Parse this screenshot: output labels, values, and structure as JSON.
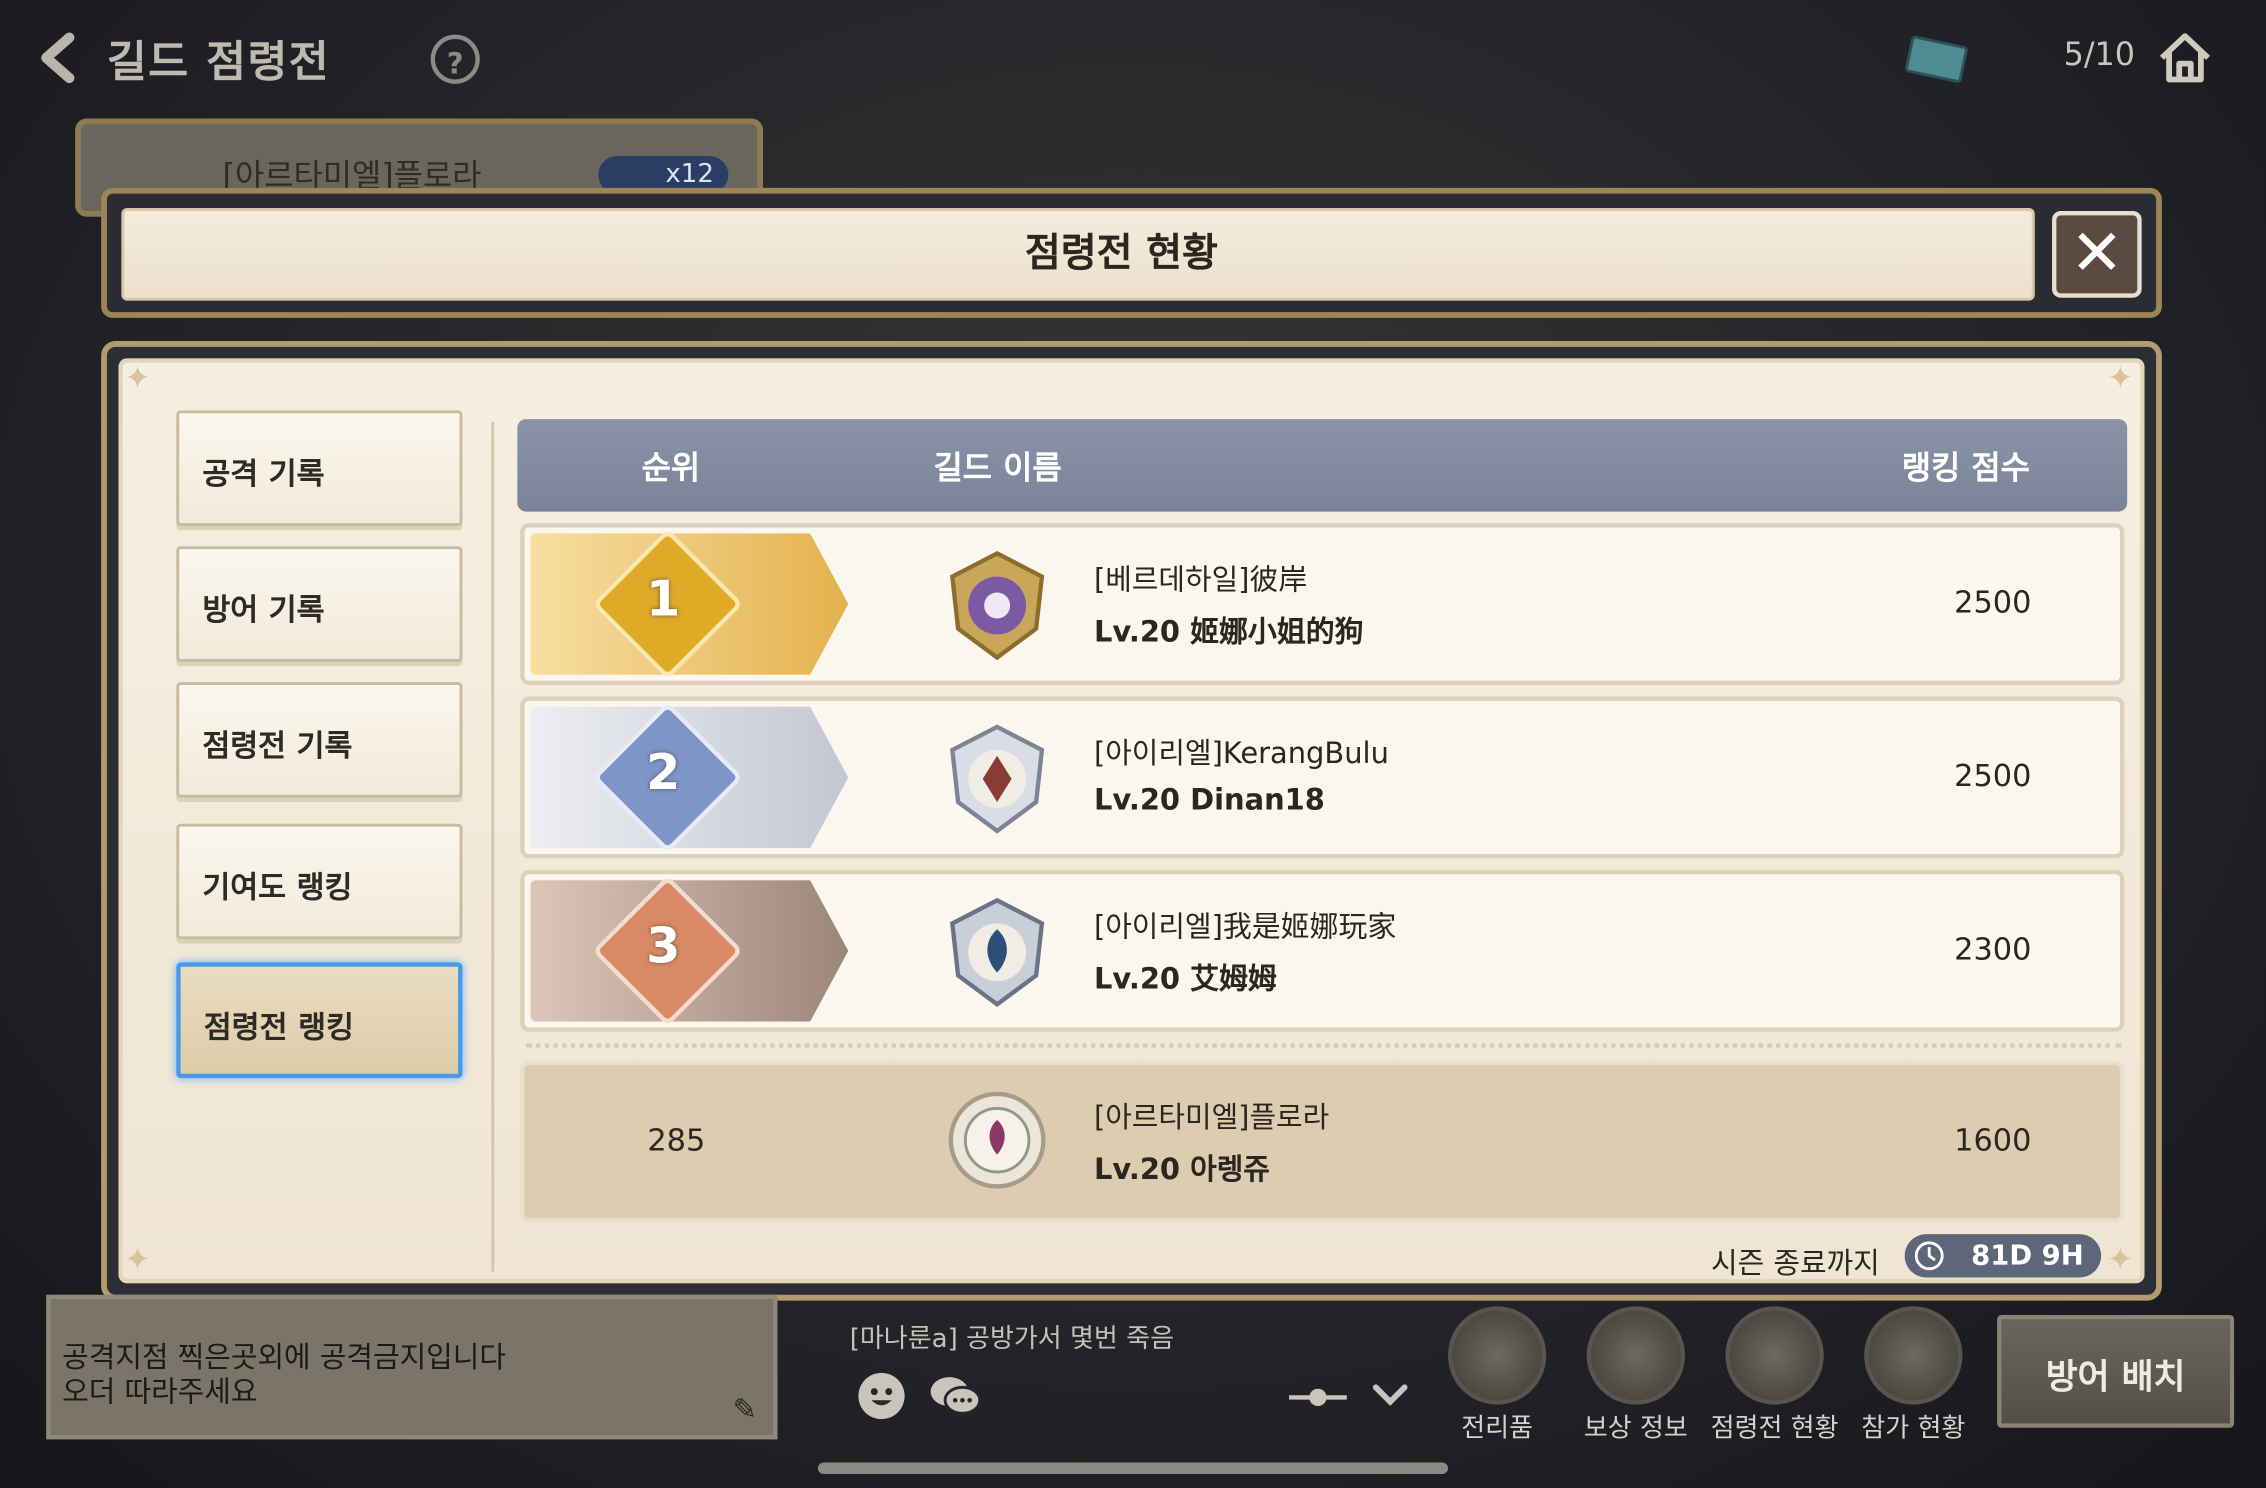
{
  "topbar": {
    "title": "길드 점령전",
    "count": "5/10"
  },
  "background_card": {
    "name": "[아르타미엘]플로라",
    "pill": "x12"
  },
  "modal": {
    "title": "점령전 현황",
    "tabs": [
      "공격 기록",
      "방어 기록",
      "점령전 기록",
      "기여도 랭킹",
      "점령전 랭킹"
    ],
    "active_tab": 4,
    "columns": {
      "rank": "순위",
      "guild": "길드 이름",
      "score": "랭킹 점수"
    },
    "rows": [
      {
        "rank": "1",
        "guild": "[베르데하일]彼岸",
        "leader": "Lv.20 姬娜小姐的狗",
        "score": "2500",
        "medal_color": "#e9b84a"
      },
      {
        "rank": "2",
        "guild": "[아이리엘]KerangBulu",
        "leader": "Lv.20 Dinan18",
        "score": "2500",
        "medal_color": "#c8cbd6"
      },
      {
        "rank": "3",
        "guild": "[아이리엘]我是姬娜玩家",
        "leader": "Lv.20 艾姆姆",
        "score": "2300",
        "medal_color": "#b79a88"
      }
    ],
    "my_row": {
      "rank": "285",
      "guild": "[아르타미엘]플로라",
      "leader": "Lv.20 아렝쥬",
      "score": "1600"
    },
    "season_label": "시즌 종료까지",
    "season_time": "81D 9H"
  },
  "notice": {
    "line1": "공격지점 찍은곳외에 공격금지입니다",
    "line2": "오더 따라주세요"
  },
  "chat_message": "[마나룬a] 공방가서 몇번 죽음",
  "menu": [
    "전리품",
    "보상 정보",
    "점령전 현황",
    "참가 현황"
  ],
  "defense_button": "방어 배치",
  "colors": {
    "accent_blue": "#4a98e8",
    "header_gray": "#7a8398",
    "gold": "#b29b6e"
  }
}
